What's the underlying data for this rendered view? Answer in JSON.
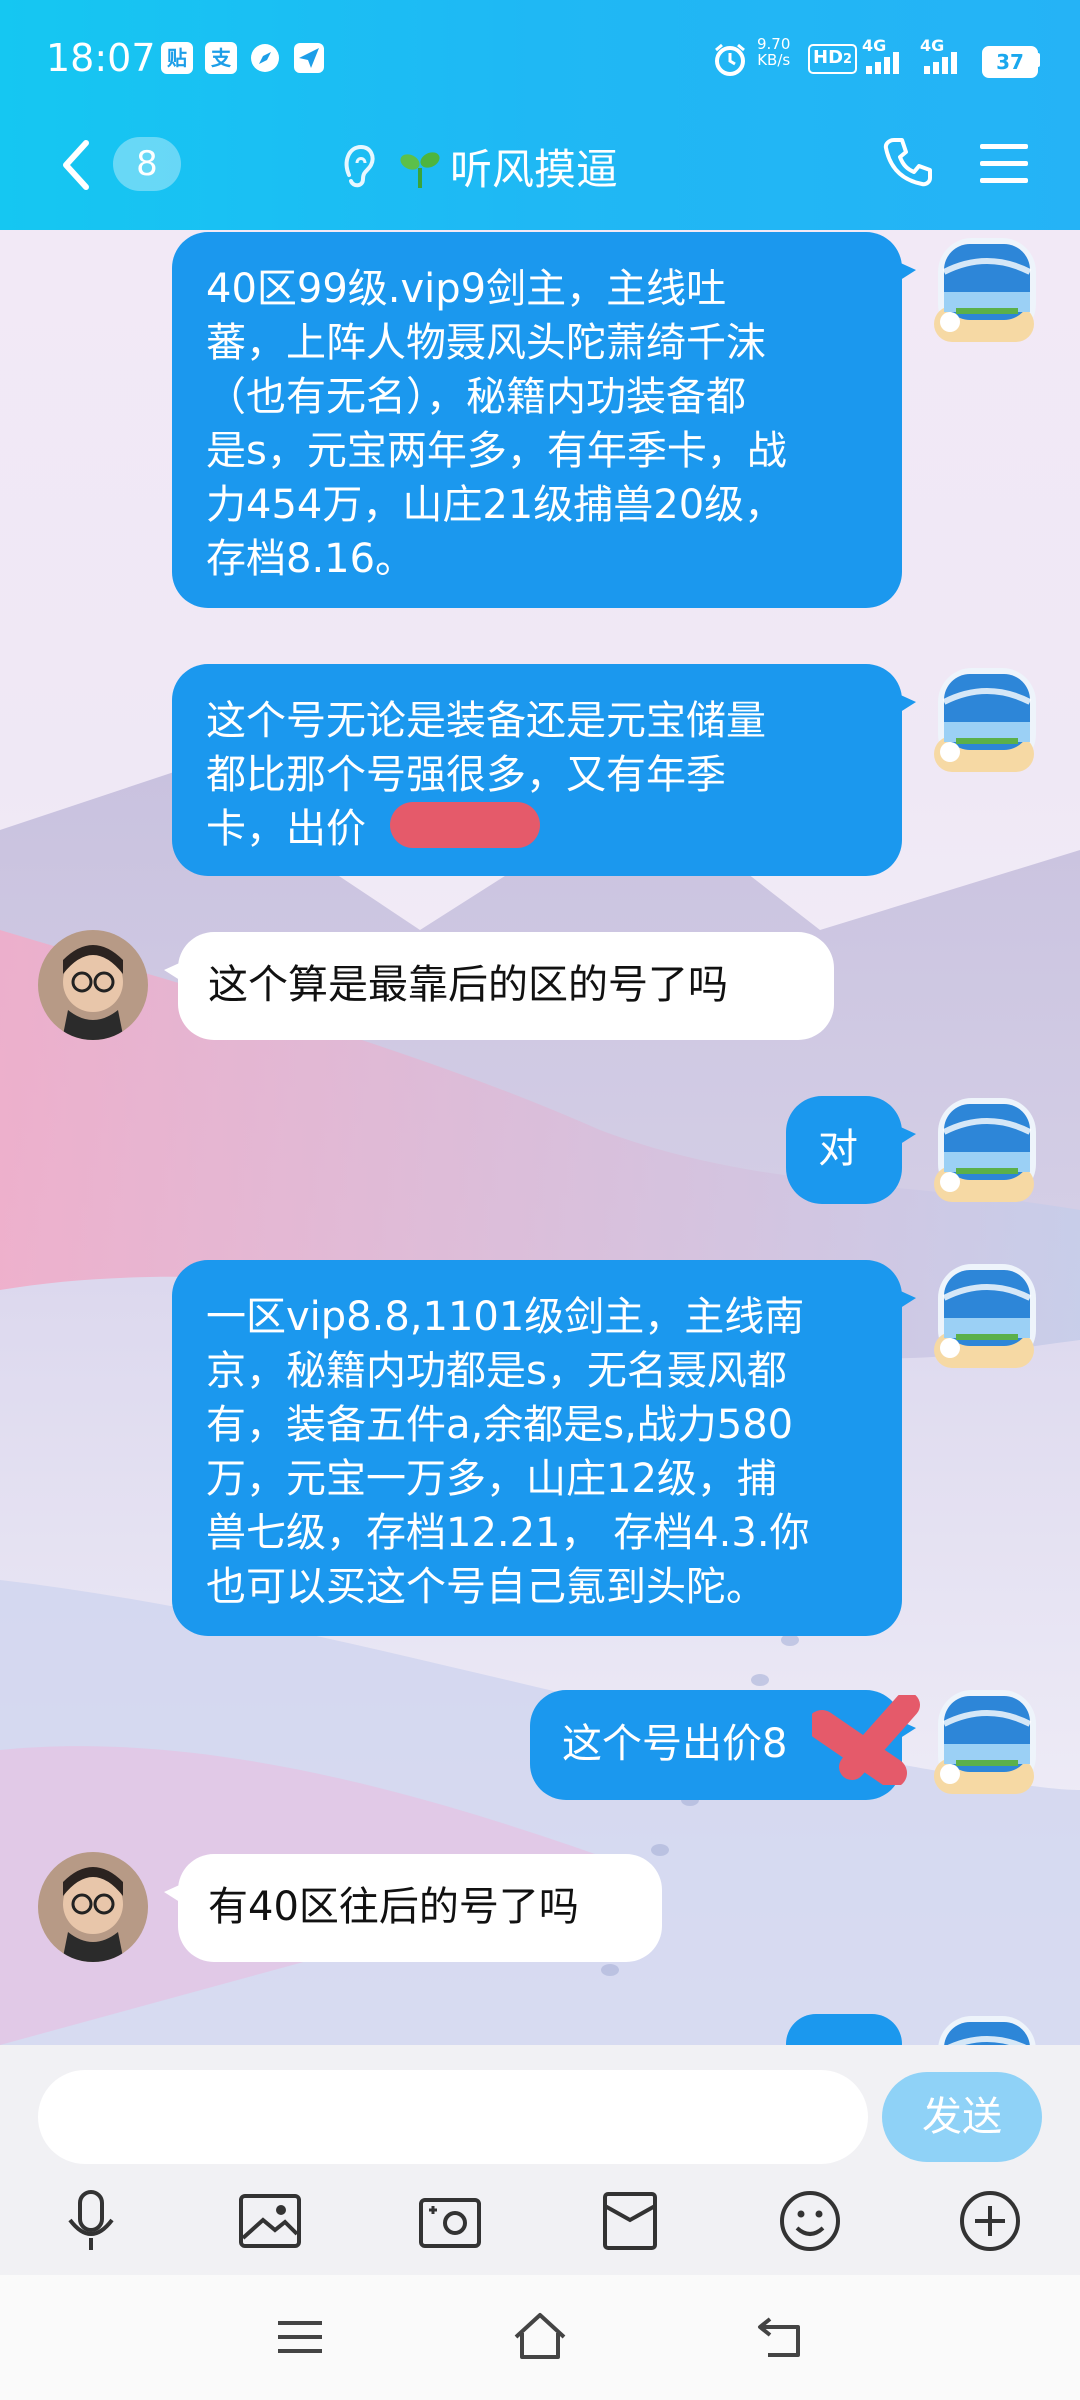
{
  "status_bar": {
    "time": "18:07",
    "net_speed_value": "9.70",
    "net_speed_unit": "KB/s",
    "hd_label": "HD",
    "hd_sub": "2",
    "signal1": "4G",
    "signal2": "4G",
    "battery": "37",
    "icons": [
      "app-icon-贴",
      "alipay-icon",
      "compass-icon",
      "send-icon",
      "alarm-icon"
    ]
  },
  "header": {
    "unread_count": "8",
    "title": "听风摸逼",
    "icons": [
      "back-icon",
      "ear-icon",
      "sprout-icon",
      "phone-icon",
      "menu-icon"
    ]
  },
  "messages": [
    {
      "side": "out",
      "text": "40区99级.vip9剑主，主线吐\n蕃，上阵人物聂风头陀萧绮千沫\n（也有无名），秘籍内功装备都\n是s，元宝两年多，有年季卡，战\n力454万，山庄21级捕兽20级，\n存档8.16。"
    },
    {
      "side": "out",
      "text": "这个号无论是装备还是元宝储量\n都比那个号强很多，又有年季\n卡，出价"
    },
    {
      "side": "in",
      "text": "这个算是最靠后的区的号了吗"
    },
    {
      "side": "out",
      "text": "对"
    },
    {
      "side": "out",
      "text": "一区vip8.8,1101级剑主，主线南\n京，秘籍内功都是s，无名聂风都\n有，装备五件a,余都是s,战力580\n万，元宝一万多，山庄12级，捕\n兽七级，存档12.21， 存档4.3.你\n也可以买这个号自己氪到头陀。"
    },
    {
      "side": "out",
      "text": "这个号出价8"
    },
    {
      "side": "in",
      "text": "有40区往后的号了吗"
    }
  ],
  "composer": {
    "input_value": "",
    "input_placeholder": "",
    "send_label": "发送"
  },
  "toolbar": [
    "microphone-icon",
    "image-icon",
    "camera-icon",
    "red-packet-icon",
    "emoji-icon",
    "plus-icon"
  ],
  "nav": [
    "menu-nav-icon",
    "home-nav-icon",
    "back-nav-icon"
  ],
  "colors": {
    "header_bg": "#1fb8f4",
    "bubble_out": "#1b98ee",
    "bubble_in": "#ffffff",
    "send_button": "#8fd2f7",
    "redaction": "#e55a6a"
  }
}
